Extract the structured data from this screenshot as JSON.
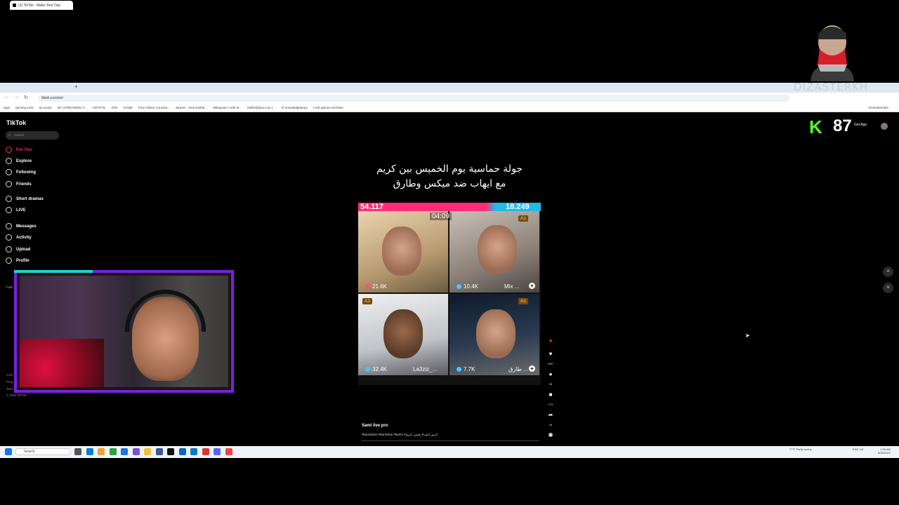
{
  "browser": {
    "tab_title": "(3) TikTok - Make Your Day",
    "url": "tiktok.com/en/",
    "bookmarks": [
      "Apps",
      "gaming tools",
      "accounts",
      "MY STREAMING T...",
      "CRYPTO",
      "APD",
      "GAME",
      "Free Online Courses...",
      "Stream - Kick Dashb...",
      "Wikiquote | UHF B...",
      "Selfie@plus.com | ...",
      "R Knowledgebrary",
      "LIVE games w/Veism"
    ],
    "all_bookmarks": "All Bookmarks"
  },
  "tiktok": {
    "logo": "TikTok",
    "search_placeholder": "Search",
    "nav": [
      {
        "label": "For You",
        "icon": "home-icon"
      },
      {
        "label": "Explore",
        "icon": "compass-icon"
      },
      {
        "label": "Following",
        "icon": "following-icon"
      },
      {
        "label": "Friends",
        "icon": "friends-icon"
      },
      {
        "label": "Short dramas",
        "icon": "dramas-icon"
      },
      {
        "label": "LIVE",
        "icon": "live-icon"
      },
      {
        "label": "Messages",
        "icon": "message-icon"
      },
      {
        "label": "Activity",
        "icon": "activity-icon"
      },
      {
        "label": "Upload",
        "icon": "upload-icon"
      },
      {
        "label": "Profile",
        "icon": "profile-icon"
      }
    ],
    "following_label": "Follo",
    "footer": [
      "Com",
      "Prog",
      "Term",
      "© 2024 TikTok"
    ],
    "get_app": "Get App"
  },
  "video": {
    "caption_line1": "جولة حماسية يوم الخميس بين كريم",
    "caption_line2": "مع ايهاب ضد ميكس وطارق",
    "score_left": "54.117",
    "score_right": "18.249",
    "timer": "04:09",
    "cells": [
      {
        "count": "21.6K",
        "name": "",
        "badge": ""
      },
      {
        "count": "10.4K",
        "name": "Mix ...",
        "badge": "A1"
      },
      {
        "count": "32.4K",
        "name": "La3ziz_...",
        "badge": "A1"
      },
      {
        "count": "7.7K",
        "name": "طارق ...",
        "badge": "A1"
      }
    ],
    "author": "Sami live pro",
    "hashtags": "#karimlive2 #karimlive #karim #كريم_لايف#_فيش_كريم",
    "actions": {
      "likes": "2957",
      "comments": "38",
      "saves": "170",
      "shares": "46"
    }
  },
  "overlay": {
    "kick_k": "K",
    "kick_count": "87",
    "brand_name": "DIZASTERKH"
  },
  "taskbar": {
    "search": "Search",
    "weather": "77°F Partly sunny",
    "lang": "ENG US",
    "time": "1:26 AM",
    "date": "8/28/2024"
  },
  "colors": {
    "accent": "#fe2c55",
    "kick": "#53fc18",
    "cam_border": "#7c1fe0"
  }
}
